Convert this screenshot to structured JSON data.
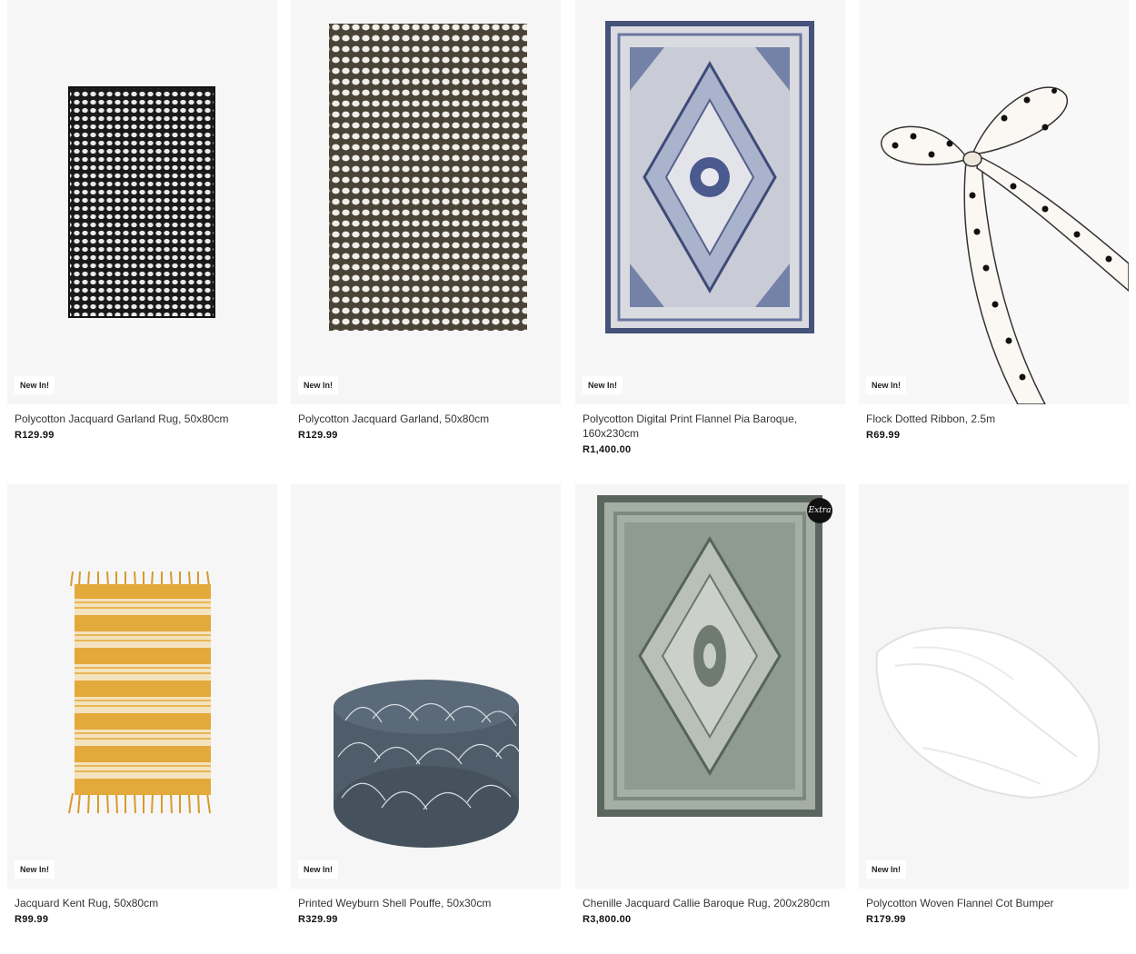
{
  "products": [
    {
      "name": "Polycotton Jacquard Garland Rug, 50x80cm",
      "price": "R129.99",
      "badge": "New In!",
      "image": "black-white-bobble-rug"
    },
    {
      "name": "Polycotton Jacquard Garland, 50x80cm",
      "price": "R129.99",
      "badge": "New In!",
      "image": "brown-white-bobble-rug"
    },
    {
      "name": "Polycotton Digital Print Flannel Pia Baroque, 160x230cm",
      "price": "R1,400.00",
      "badge": "New In!",
      "image": "blue-baroque-rug"
    },
    {
      "name": "Flock Dotted Ribbon, 2.5m",
      "price": "R69.99",
      "badge": "New In!",
      "image": "dotted-ribbon-bow"
    },
    {
      "name": "Jacquard Kent Rug, 50x80cm",
      "price": "R99.99",
      "badge": "New In!",
      "image": "yellow-striped-rug"
    },
    {
      "name": "Printed Weyburn Shell Pouffe, 50x30cm",
      "price": "R329.99",
      "badge": "New In!",
      "image": "blue-shell-pouffe"
    },
    {
      "name": "Chenille Jacquard Callie Baroque Rug, 200x280cm",
      "price": "R3,800.00",
      "badge": "",
      "extra_badge": "Extra",
      "image": "green-baroque-rug"
    },
    {
      "name": "Polycotton Woven Flannel Cot Bumper",
      "price": "R179.99",
      "badge": "New In!",
      "image": "white-cot-bumper"
    }
  ]
}
